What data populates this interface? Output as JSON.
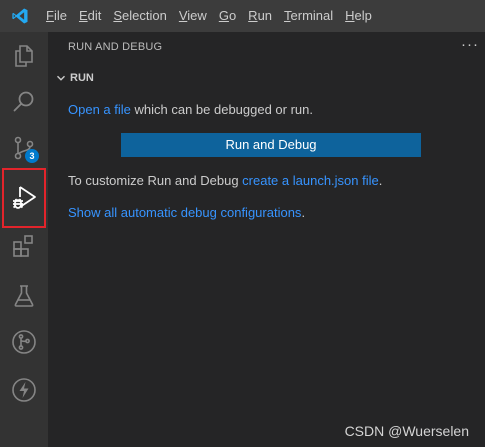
{
  "menubar": {
    "logo_icon": "vscode-logo-icon",
    "items": [
      {
        "mnemonic": "F",
        "rest": "ile"
      },
      {
        "mnemonic": "E",
        "rest": "dit"
      },
      {
        "mnemonic": "S",
        "rest": "election"
      },
      {
        "mnemonic": "V",
        "rest": "iew"
      },
      {
        "mnemonic": "G",
        "rest": "o"
      },
      {
        "mnemonic": "R",
        "rest": "un"
      },
      {
        "mnemonic": "T",
        "rest": "erminal"
      },
      {
        "mnemonic": "H",
        "rest": "elp"
      }
    ]
  },
  "activitybar": {
    "icons": [
      "explorer-icon",
      "search-icon",
      "source-control-icon",
      "run-debug-icon",
      "extensions-icon",
      "testing-icon",
      "git-graph-icon",
      "thunder-client-icon"
    ],
    "source_control_badge": "3"
  },
  "sidebar": {
    "title": "RUN AND DEBUG",
    "more_actions": "···",
    "section_title": "RUN",
    "line1_link": "Open a file",
    "line1_text": " which can be debugged or run.",
    "run_button_label": "Run and Debug",
    "line2_text": "To customize Run and Debug ",
    "line2_link": "create a launch.json file",
    "line2_end": ".",
    "line3_link": "Show all automatic debug configurations",
    "line3_end": "."
  },
  "watermark": "CSDN @Wuerselen",
  "colors": {
    "menubar_bg": "#3c3c3c",
    "activitybar_bg": "#333333",
    "sidebar_bg": "#252526",
    "button_bg": "#0e639c",
    "link": "#3794ff",
    "badge": "#007acc",
    "highlight_border": "#e3242b"
  }
}
